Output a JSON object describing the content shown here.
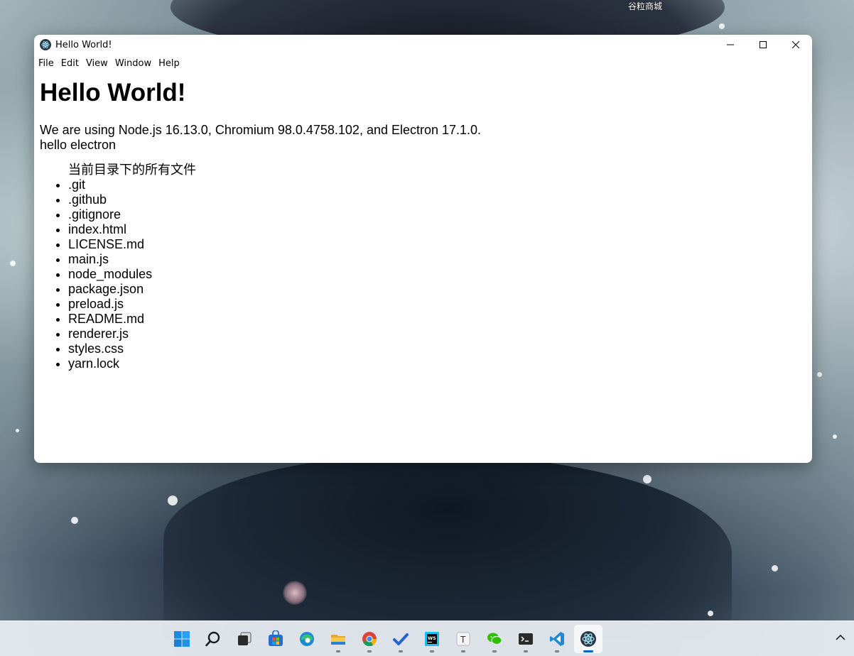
{
  "desktop": {
    "label": "谷粒商城"
  },
  "window": {
    "title": "Hello World!",
    "menu": [
      "File",
      "Edit",
      "View",
      "Window",
      "Help"
    ],
    "controls": {
      "minimize_icon": "minimize-icon",
      "maximize_icon": "maximize-icon",
      "close_icon": "close-icon"
    }
  },
  "content": {
    "heading": "Hello World!",
    "versions_line": "We are using Node.js 16.13.0, Chromium 98.0.4758.102, and Electron 17.1.0.",
    "greeting": "hello electron",
    "list_title": "当前目录下的所有文件",
    "files": [
      ".git",
      ".github",
      ".gitignore",
      "index.html",
      "LICENSE.md",
      "main.js",
      "node_modules",
      "package.json",
      "preload.js",
      "README.md",
      "renderer.js",
      "styles.css",
      "yarn.lock"
    ]
  },
  "taskbar": {
    "icons": [
      "start-icon",
      "search-icon",
      "task-view-icon",
      "store-icon",
      "edge-icon",
      "file-explorer-icon",
      "chrome-icon",
      "todo-icon",
      "webstorm-icon",
      "typora-icon",
      "wechat-icon",
      "terminal-icon",
      "vscode-icon",
      "electron-icon"
    ],
    "active_icon": "electron-icon",
    "colors": {
      "accent": "#0067c0"
    }
  }
}
